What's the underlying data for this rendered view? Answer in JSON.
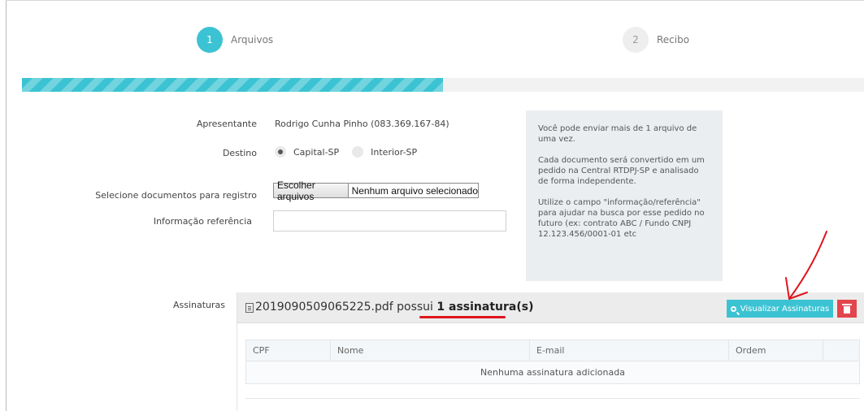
{
  "wizard": {
    "steps": [
      {
        "number": "1",
        "label": "Arquivos"
      },
      {
        "number": "2",
        "label": "Recibo"
      }
    ],
    "progress_fraction": 0.5
  },
  "form": {
    "apresentante": {
      "label": "Apresentante",
      "value": "Rodrigo Cunha Pinho (083.369.167-84)"
    },
    "destino": {
      "label": "Destino",
      "options": [
        "Capital-SP",
        "Interior-SP"
      ],
      "selected": "Capital-SP"
    },
    "documentos": {
      "label": "Selecione documentos para registro",
      "button": "Escolher arquivos",
      "status": "Nenhum arquivo selecionado"
    },
    "informacao": {
      "label": "Informação referência",
      "value": ""
    }
  },
  "info_box": {
    "paragraphs": [
      "Você pode enviar mais de 1 arquivo de uma vez.",
      "Cada documento será convertido em um pedido na Central RTDPJ-SP e analisado de forma independente.",
      "Utilize o campo \"informação/referência\" para ajudar na busca por esse pedido no futuro (ex: contrato ABC / Fundo CNPJ 12.123.456/0001-01 etc"
    ]
  },
  "signatures": {
    "label": "Assinaturas",
    "file_name": "2019090509065225.pdf",
    "possui_text": "possui",
    "count_text": "1 assinatura(s)",
    "view_button": "Visualizar Assinaturas",
    "table": {
      "columns": [
        "CPF",
        "Nome",
        "E-mail",
        "Ordem",
        ""
      ],
      "empty_message": "Nenhuma assinatura adicionada"
    }
  },
  "colors": {
    "accent": "#3cc3d3",
    "danger": "#e2454e",
    "annotation": "#e0141d"
  }
}
